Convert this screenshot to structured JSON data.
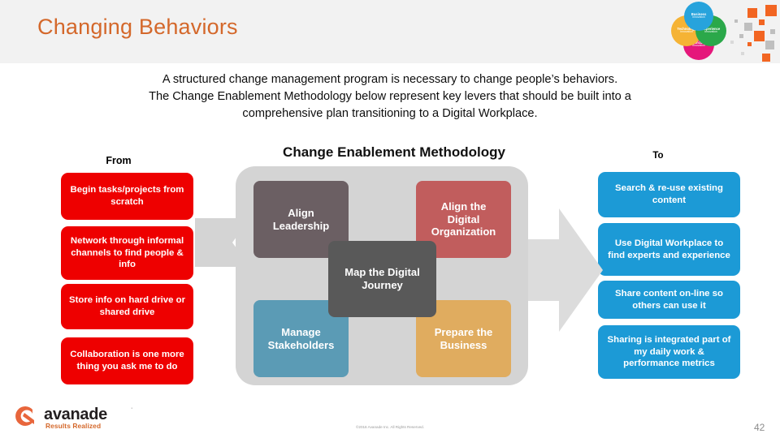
{
  "header": {
    "title": "Changing Behaviors",
    "accent_color": "#D4682B",
    "background_color": "#F2F2F2"
  },
  "logo_venn": {
    "name": "avanade-venn-logo",
    "circles": [
      {
        "id": "business",
        "line1": "Business",
        "line2": "Innovation",
        "color": "#27A3DC"
      },
      {
        "id": "technology",
        "line1": "Technology",
        "line2": "Innovation",
        "color": "#F5B335"
      },
      {
        "id": "experience",
        "line1": "Experience",
        "line2": "Innovation",
        "color": "#2BA84A"
      },
      {
        "id": "organization",
        "line1": "Organization",
        "line2": "Innovation",
        "color": "#E5177B"
      }
    ]
  },
  "subtitle": {
    "line1": "A structured change management program is necessary to change people’s behaviors.",
    "line2": "The Change Enablement Methodology below represent key levers that should be built into a",
    "line3": "comprehensive plan transitioning to a Digital Workplace."
  },
  "columns": {
    "from_heading": "From",
    "to_heading": "To",
    "from_color": "#EE0000",
    "to_color": "#1C9AD6"
  },
  "from_items": [
    {
      "text": "Begin tasks/projects from scratch"
    },
    {
      "text": "Network through informal channels to find people & info"
    },
    {
      "text": "Store info on hard drive or shared drive"
    },
    {
      "text": "Collaboration is one more thing you ask me to do"
    }
  ],
  "to_items": [
    {
      "text": "Search & re-use existing content"
    },
    {
      "text": "Use Digital Workplace to find experts and experience"
    },
    {
      "text": "Share content on-line so others can use it"
    },
    {
      "text": "Sharing is integrated part of my daily work & performance metrics"
    }
  ],
  "methodology": {
    "title": "Change Enablement Methodology",
    "boxes": [
      {
        "id": "align-leadership",
        "label": "Align\nLeadership",
        "color": "#6B5F63"
      },
      {
        "id": "align-digital-org",
        "label": "Align the\nDigital\nOrganization",
        "color": "#C15D5D"
      },
      {
        "id": "map-the-digital-journey",
        "label": "Map the Digital\nJourney",
        "color": "#595959"
      },
      {
        "id": "manage-stakeholders",
        "label": "Manage\nStakeholders",
        "color": "#5B9BB5"
      },
      {
        "id": "prepare-the-business",
        "label": "Prepare the\nBusiness",
        "color": "#E0AC5F"
      }
    ],
    "container_color": "#D4D4D4",
    "arrow_color": "#DCDCDC"
  },
  "footer": {
    "brand": "avanade",
    "trademark": "·",
    "tagline": "Results Realized",
    "copyright": "©2016 Avanade Inc. All Rights Reserved.",
    "page_number": "42"
  }
}
